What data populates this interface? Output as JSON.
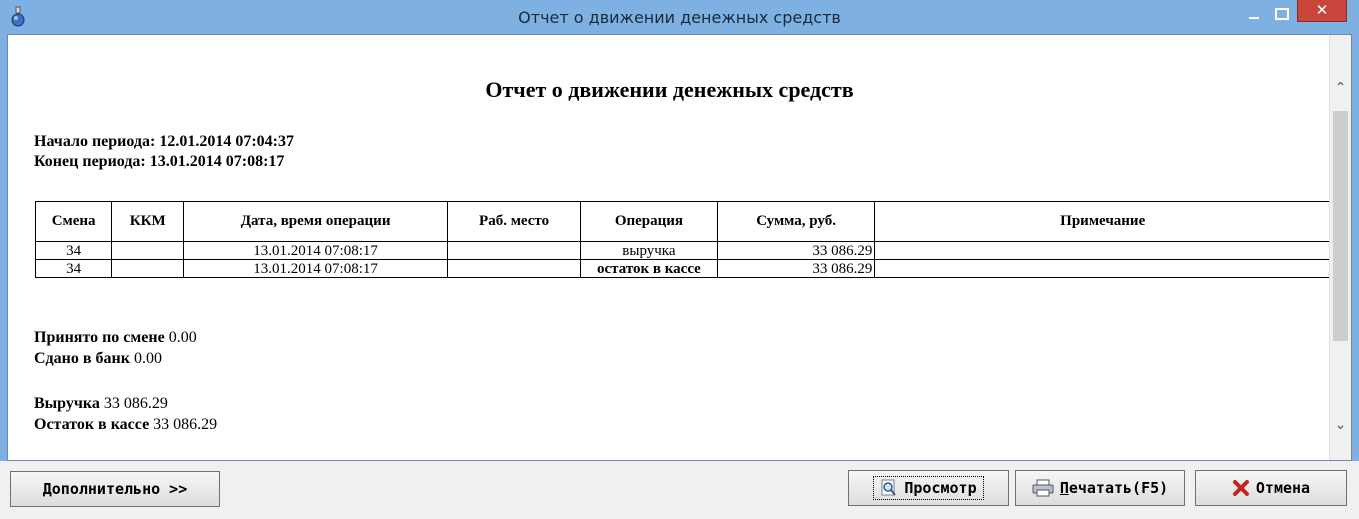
{
  "window": {
    "title": "Отчет о движении денежных средств"
  },
  "report": {
    "title": "Отчет о движении денежных средств",
    "period_start_label": "Начало периода:",
    "period_start_value": "12.01.2014 07:04:37",
    "period_end_label": "Конец периода:",
    "period_end_value": "13.01.2014 07:08:17",
    "table": {
      "headers": [
        "Смена",
        "ККМ",
        "Дата, время операции",
        "Раб. место",
        "Операция",
        "Сумма, руб.",
        "Примечание"
      ],
      "rows": [
        {
          "shift": "34",
          "kkm": "",
          "datetime": "13.01.2014 07:08:17",
          "workplace": "",
          "operation": "выручка",
          "sum": "33 086.29",
          "note": ""
        },
        {
          "shift": "34",
          "kkm": "",
          "datetime": "13.01.2014 07:08:17",
          "workplace": "",
          "operation": "остаток в кассе",
          "sum": "33 086.29",
          "note": ""
        }
      ]
    },
    "accepted_label": "Принято по смене",
    "accepted_value": "0.00",
    "bank_label": "Сдано в банк",
    "bank_value": "0.00",
    "revenue_label": "Выручка",
    "revenue_value": "33 086.29",
    "balance_label": "Остаток в кассе",
    "balance_value": "33 086.29"
  },
  "buttons": {
    "more": "Дополнительно >>",
    "preview": "Просмотр",
    "print_u": "П",
    "print_rest": "ечатать(F5)",
    "cancel": "Отмена"
  },
  "colors": {
    "titlebar": "#7fb0e2",
    "close": "#c8463c",
    "cancel_icon": "#c0261c"
  }
}
